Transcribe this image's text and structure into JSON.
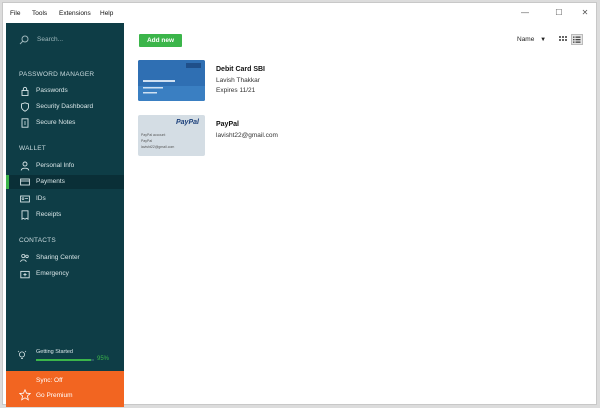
{
  "menu": [
    "File",
    "Tools",
    "Extensions",
    "Help"
  ],
  "window_controls": {
    "minimize": "—",
    "maximize": "☐",
    "close": "✕"
  },
  "sidebar": {
    "search_placeholder": "Search...",
    "sections": {
      "password_manager": "PASSWORD MANAGER",
      "wallet": "WALLET",
      "contacts": "CONTACTS"
    },
    "items": [
      {
        "label": "Passwords",
        "icon": "lock-icon"
      },
      {
        "label": "Security Dashboard",
        "icon": "shield-icon"
      },
      {
        "label": "Secure Notes",
        "icon": "note-icon"
      },
      {
        "label": "Personal Info",
        "icon": "person-icon"
      },
      {
        "label": "Payments",
        "icon": "card-icon"
      },
      {
        "label": "IDs",
        "icon": "id-icon"
      },
      {
        "label": "Receipts",
        "icon": "receipt-icon"
      },
      {
        "label": "Sharing Center",
        "icon": "sharing-icon"
      },
      {
        "label": "Emergency",
        "icon": "emergency-icon"
      }
    ],
    "active_item": "Payments",
    "getting_started": {
      "label": "Getting Started",
      "percent_text": "95%",
      "progress": 0.95
    },
    "premium": {
      "sync": "Sync: Off",
      "go": "Go Premium"
    }
  },
  "main": {
    "add_button": "Add new",
    "sort_label": "Name",
    "items": [
      {
        "title": "Debit Card SBI",
        "line1": "Lavish Thakkar",
        "line2": "Expires 11/21"
      },
      {
        "title": "PayPal",
        "line1": "lavisht22@gmail.com",
        "line2": ""
      }
    ],
    "paypal_thumb": {
      "logo": "PayPal",
      "line1": "PayPal account",
      "line2": "PayPal",
      "line3": "lavisht22@gmail.com"
    }
  },
  "colors": {
    "sidebar": "#0e3d46",
    "accent_green": "#3bb54a",
    "premium_orange": "#f26521"
  }
}
